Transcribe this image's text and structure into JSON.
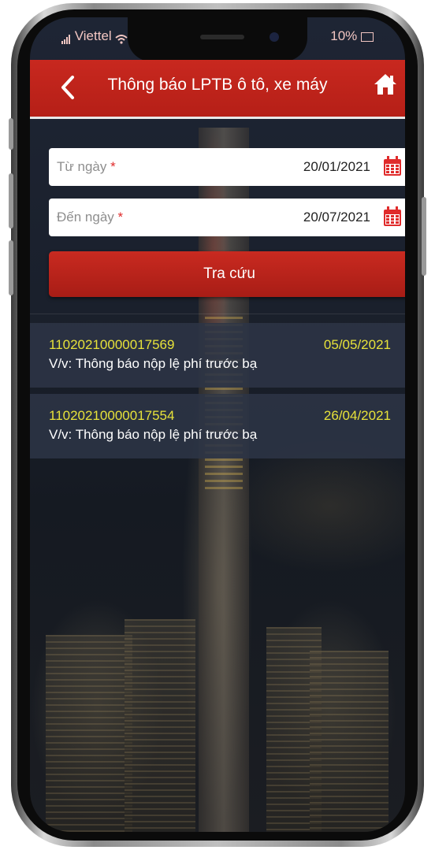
{
  "status_bar": {
    "carrier": "Viettel",
    "battery": "10%"
  },
  "header": {
    "title": "Thông báo LPTB ô tô, xe máy"
  },
  "form": {
    "from_date": {
      "label": "Từ ngày",
      "required_mark": "*",
      "value": "20/01/2021"
    },
    "to_date": {
      "label": "Đến ngày",
      "required_mark": "*",
      "value": "20/07/2021"
    },
    "search_label": "Tra cứu"
  },
  "results": [
    {
      "code": "11020210000017569",
      "date": "05/05/2021",
      "description": "V/v: Thông báo nộp lệ phí trước bạ"
    },
    {
      "code": "11020210000017554",
      "date": "26/04/2021",
      "description": "V/v: Thông báo nộp lệ phí trước bạ"
    }
  ],
  "colors": {
    "header_red": "#c8281f",
    "accent_yellow": "#e7e23a",
    "button_red": "#b51f17"
  },
  "icons": [
    "back-arrow-icon",
    "home-icon",
    "calendar-icon",
    "wifi-icon",
    "signal-icon"
  ]
}
